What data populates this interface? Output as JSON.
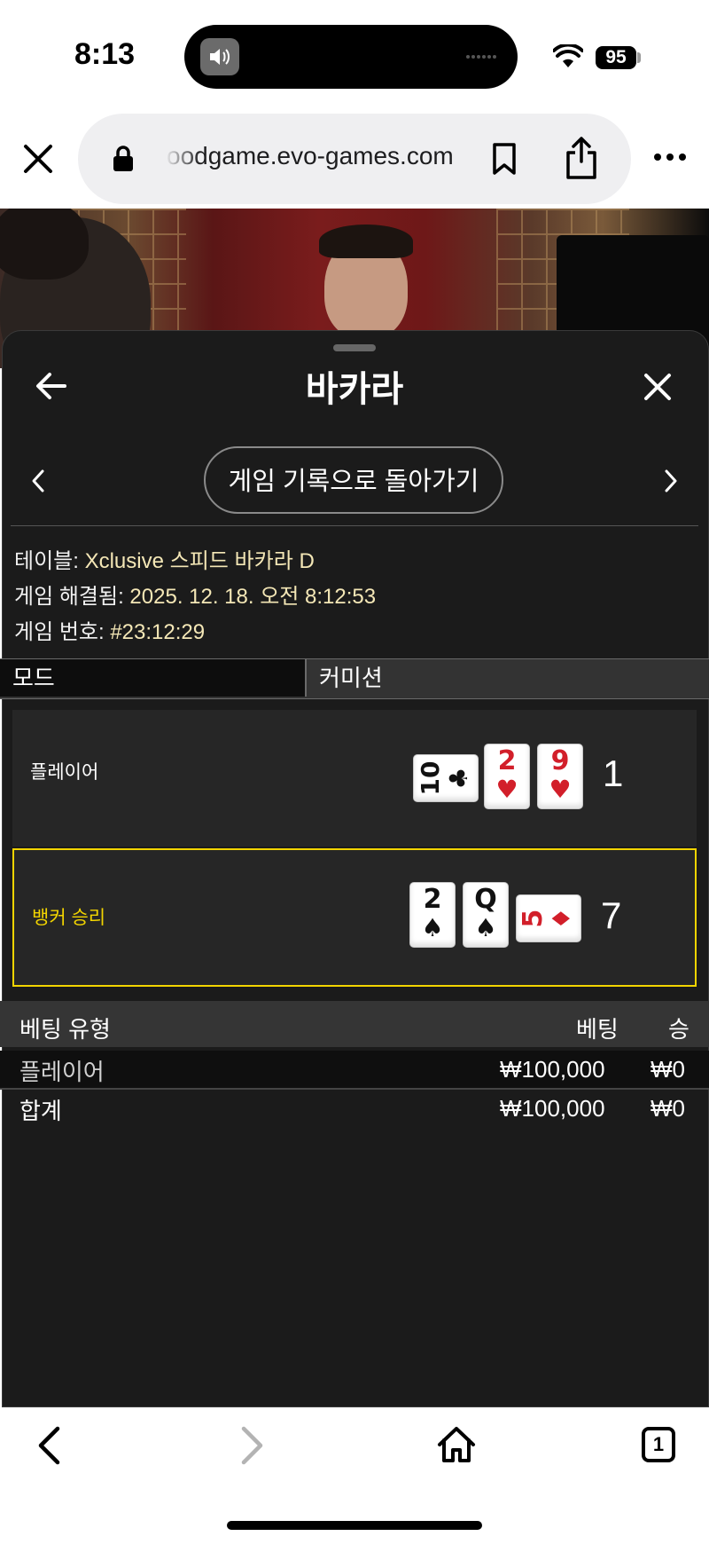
{
  "status_bar": {
    "time": "8:13",
    "battery": "95"
  },
  "browser": {
    "url": "oodgame.evo-games.com",
    "tabs_count": "1"
  },
  "panel": {
    "title": "바카라",
    "back_to_history": "게임 기록으로 돌아가기",
    "info": {
      "table_label": "테이블:",
      "table_value": "Xclusive 스피드 바카라 D",
      "resolved_label": "게임 해결됨:",
      "resolved_value": "2025. 12. 18. 오전 8:12:53",
      "game_no_label": "게임 번호:",
      "game_no_value": "#23:12:29"
    },
    "mode_label": "모드",
    "mode_value": "커미션",
    "results": [
      {
        "label": "플레이어",
        "score": "1",
        "winner": false,
        "cards": [
          {
            "rank": "10",
            "suit": "♣",
            "color": "#111111",
            "orientation": "sideways"
          },
          {
            "rank": "2",
            "suit": "♥",
            "color": "#d21f2a",
            "orientation": "upright"
          },
          {
            "rank": "9",
            "suit": "♥",
            "color": "#d21f2a",
            "orientation": "upright"
          }
        ]
      },
      {
        "label": "뱅커 승리",
        "score": "7",
        "winner": true,
        "cards": [
          {
            "rank": "2",
            "suit": "♠",
            "color": "#111111",
            "orientation": "upright"
          },
          {
            "rank": "Q",
            "suit": "♠",
            "color": "#111111",
            "orientation": "upright"
          },
          {
            "rank": "5",
            "suit": "♦",
            "color": "#d21f2a",
            "orientation": "sideways"
          }
        ]
      }
    ],
    "bets": {
      "headers": {
        "type": "베팅 유형",
        "bet": "베팅",
        "win": "승"
      },
      "rows": [
        {
          "type": "플레이어",
          "bet": "₩100,000",
          "win": "₩0"
        }
      ],
      "total": {
        "type": "합계",
        "bet": "₩100,000",
        "win": "₩0"
      }
    }
  },
  "colors": {
    "panel_bg": "#1b1b1b",
    "info_value": "#f4e7b6",
    "winner_accent": "#f2d400",
    "card_red": "#d21f2a"
  }
}
